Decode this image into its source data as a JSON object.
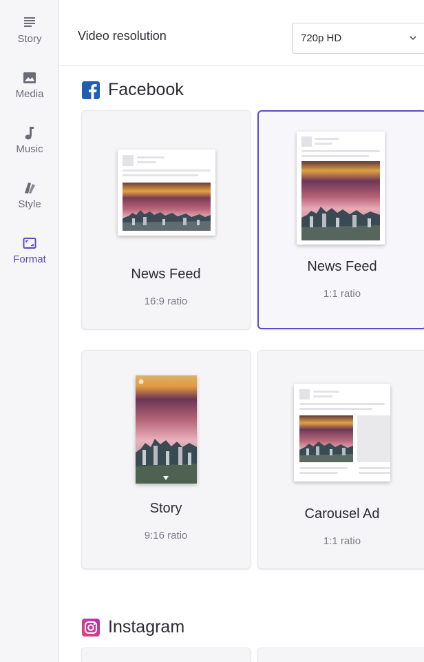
{
  "sidebar": {
    "items": [
      {
        "label": "Story",
        "icon": "lines-icon"
      },
      {
        "label": "Media",
        "icon": "image-icon"
      },
      {
        "label": "Music",
        "icon": "music-note-icon"
      },
      {
        "label": "Style",
        "icon": "swatches-icon"
      },
      {
        "label": "Format",
        "icon": "frame-icon"
      }
    ],
    "active": "Format"
  },
  "settings": {
    "resolution_label": "Video resolution",
    "resolution_value": "720p HD"
  },
  "facebook": {
    "title": "Facebook",
    "cards": [
      {
        "name": "News Feed",
        "ratio": "16:9 ratio",
        "selected": false
      },
      {
        "name": "News Feed",
        "ratio": "1:1 ratio",
        "selected": true
      },
      {
        "name": "Story",
        "ratio": "9:16 ratio",
        "selected": false
      },
      {
        "name": "Carousel Ad",
        "ratio": "1:1 ratio",
        "selected": false
      }
    ]
  },
  "instagram": {
    "title": "Instagram"
  },
  "colors": {
    "accent": "#5a48c7",
    "facebook_blue": "#1f5fb0",
    "instagram_pink": "#c23aa5"
  }
}
